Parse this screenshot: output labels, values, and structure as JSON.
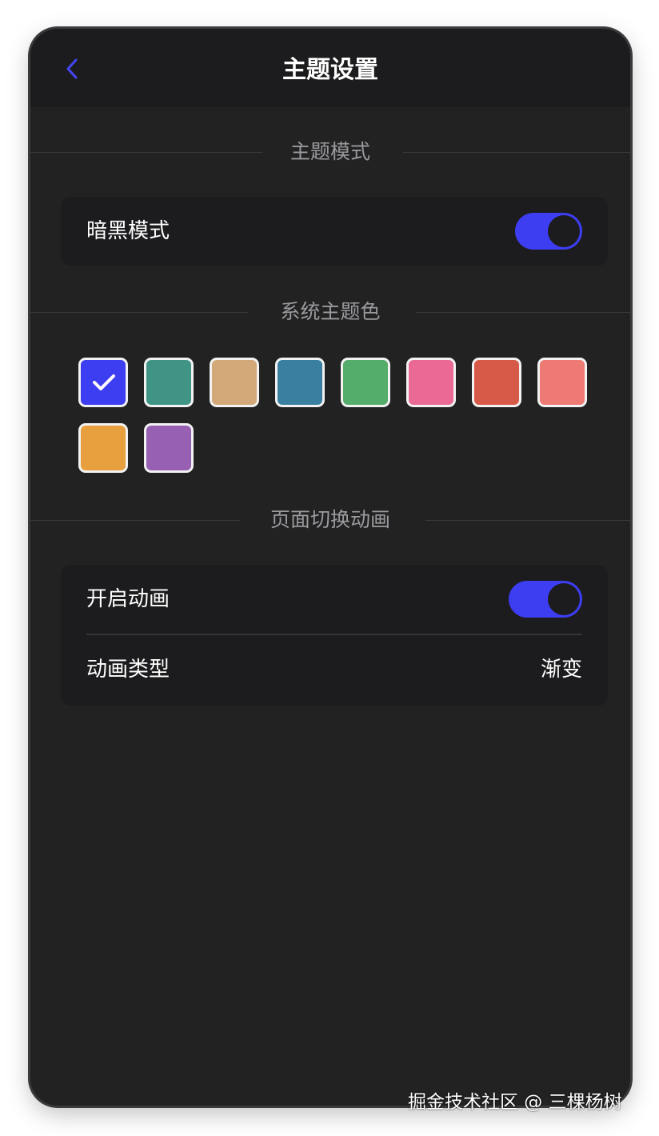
{
  "navbar": {
    "title": "主题设置",
    "back_icon": "chevron-left-icon"
  },
  "sections": {
    "theme_mode": "主题模式",
    "system_color": "系统主题色",
    "page_transition": "页面切换动画"
  },
  "theme_mode_card": {
    "dark_mode_label": "暗黑模式",
    "dark_mode_on": true
  },
  "theme_colors": {
    "selected_index": 0,
    "swatches": [
      "#3d3df2",
      "#3f9486",
      "#d3a97a",
      "#3a7ea0",
      "#55ad6b",
      "#ea6995",
      "#d75a48",
      "#ee7a74",
      "#e8a03e",
      "#9760b3"
    ]
  },
  "animation_card": {
    "enable_label": "开启动画",
    "enable_on": true,
    "type_label": "动画类型",
    "type_value": "渐变"
  },
  "colors": {
    "accent": "#3d3df2",
    "background": "#222223",
    "card": "#1c1c1e"
  },
  "watermark": "掘金技术社区 @ 三棵杨树"
}
